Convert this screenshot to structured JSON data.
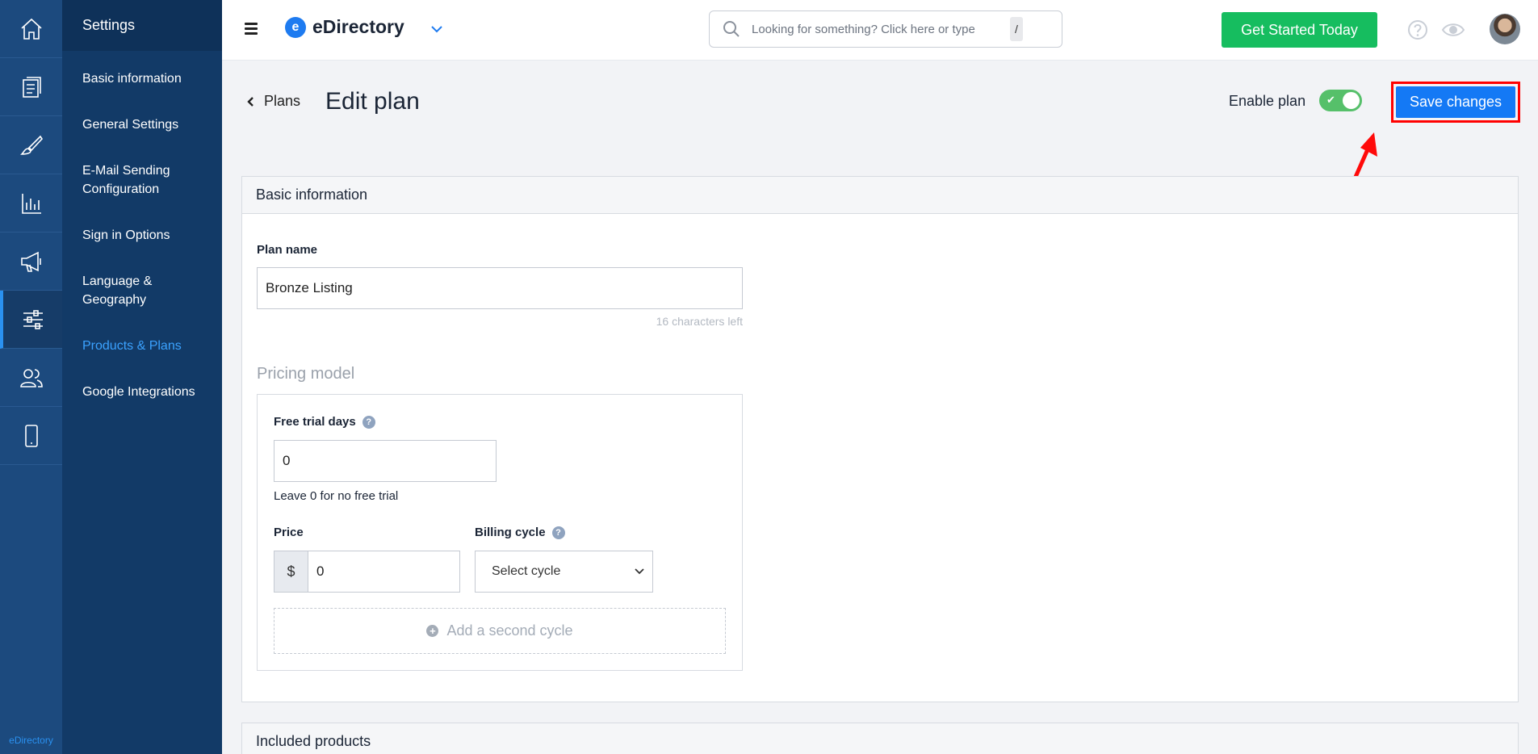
{
  "rail": {
    "items": [
      {
        "icon": "home-icon"
      },
      {
        "icon": "content-icon"
      },
      {
        "icon": "brush-icon"
      },
      {
        "icon": "reports-icon"
      },
      {
        "icon": "promote-icon"
      },
      {
        "icon": "settings-sliders-icon",
        "active": true
      },
      {
        "icon": "users-icon"
      },
      {
        "icon": "mobile-icon"
      }
    ],
    "brand": "eDirectory"
  },
  "menu": {
    "title": "Settings",
    "items": [
      {
        "label": "Basic information"
      },
      {
        "label": "General Settings"
      },
      {
        "label": "E-Mail Sending Configuration"
      },
      {
        "label": "Sign in Options"
      },
      {
        "label": "Language & Geography"
      },
      {
        "label": "Products & Plans",
        "active": true
      },
      {
        "label": "Google Integrations"
      }
    ]
  },
  "topbar": {
    "logo_text": "eDirectory",
    "logo_letter": "e",
    "search_placeholder": "Looking for something? Click here or type",
    "search_shortcut": "/",
    "cta_label": "Get Started Today"
  },
  "header": {
    "back_label": "Plans",
    "title": "Edit plan",
    "enable_label": "Enable plan",
    "enable_on": true,
    "save_label": "Save changes"
  },
  "basic_info": {
    "title": "Basic information",
    "plan_name_label": "Plan name",
    "plan_name_value": "Bronze Listing",
    "chars_left": "16 characters left",
    "pricing_title": "Pricing model",
    "free_trial_label": "Free trial days",
    "free_trial_value": "0",
    "free_trial_hint": "Leave 0 for no free trial",
    "price_label": "Price",
    "currency": "$",
    "price_value": "0",
    "billing_label": "Billing cycle",
    "billing_selected": "Select cycle",
    "add_cycle": "Add a second cycle"
  },
  "included_products": {
    "title": "Included products"
  },
  "colors": {
    "rail": "#1c4a7e",
    "menu": "#123a67",
    "accent": "#1479f5",
    "cta": "#16bd5f",
    "highlight": "#ff0000"
  }
}
